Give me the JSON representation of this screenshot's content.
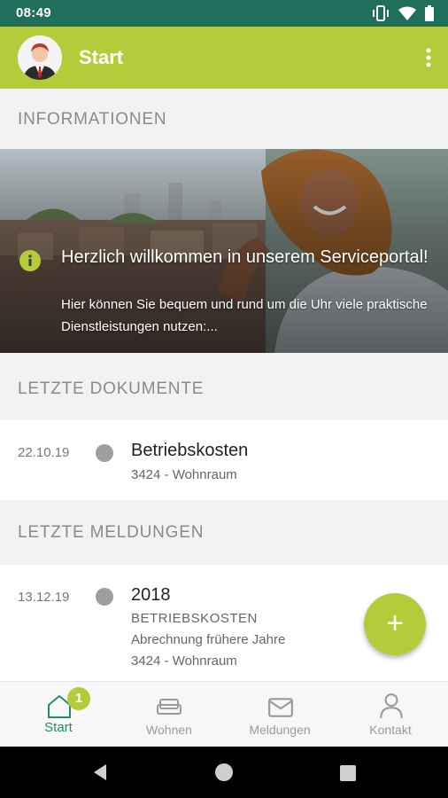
{
  "status": {
    "time": "08:49"
  },
  "appbar": {
    "title": "Start"
  },
  "sections": {
    "informationen": "INFORMATIONEN",
    "dokumente": "LETZTE DOKUMENTE",
    "meldungen": "LETZTE MELDUNGEN"
  },
  "hero": {
    "title": "Herzlich willkommen in unserem Serviceportal!",
    "text": "Hier können Sie bequem und rund um die Uhr viele praktische Dienstleistungen nutzen:..."
  },
  "documents": [
    {
      "date": "22.10.19",
      "title": "Betriebskosten",
      "subtitle": "3424 - Wohnraum"
    }
  ],
  "messages": [
    {
      "date": "13.12.19",
      "title": "2018",
      "category": "BETRIEBSKOSTEN",
      "description": "Abrechnung frühere Jahre",
      "subtitle": "3424 - Wohnraum"
    }
  ],
  "bottom_nav": {
    "start": "Start",
    "start_badge": "1",
    "wohnen": "Wohnen",
    "meldungen": "Meldungen",
    "kontakt": "Kontakt"
  },
  "colors": {
    "accent": "#b5cc3a",
    "status_bar": "#1f6f5c",
    "active_nav": "#1f8f6f"
  },
  "icons": {
    "fab": "plus-icon",
    "info": "info-icon",
    "nav": [
      "home-icon",
      "sofa-icon",
      "mail-icon",
      "person-icon"
    ]
  }
}
